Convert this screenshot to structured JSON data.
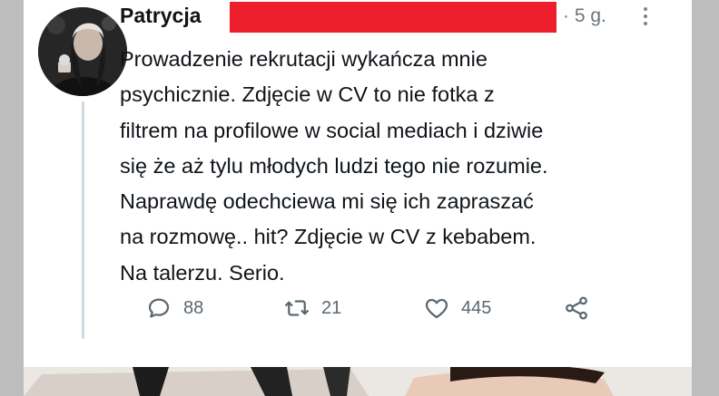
{
  "tweet": {
    "author_name": "Patrycja",
    "time": "· 5 g.",
    "text_lines": [
      "Prowadzenie rekrutacji wykańcza mnie",
      "psychicznie. Zdjęcie w CV to nie fotka z",
      "filtrem na profilowe w social mediach i dziwie",
      "się że aż tylu młodych ludzi tego nie rozumie.",
      "Naprawdę odechciewa mi się ich zapraszać",
      "na rozmowę.. hit? Zdjęcie w CV z kebabem.",
      "Na talerzu. Serio."
    ],
    "actions": {
      "replies": "88",
      "retweets": "21",
      "likes": "445"
    }
  },
  "icons": {
    "reply": "reply-icon",
    "retweet": "retweet-icon",
    "like": "heart-icon",
    "share": "share-icon",
    "more": "more-options-icon"
  },
  "colors": {
    "redaction": "#ed1f2c",
    "text": "#0f1419",
    "muted": "#5b6770"
  }
}
